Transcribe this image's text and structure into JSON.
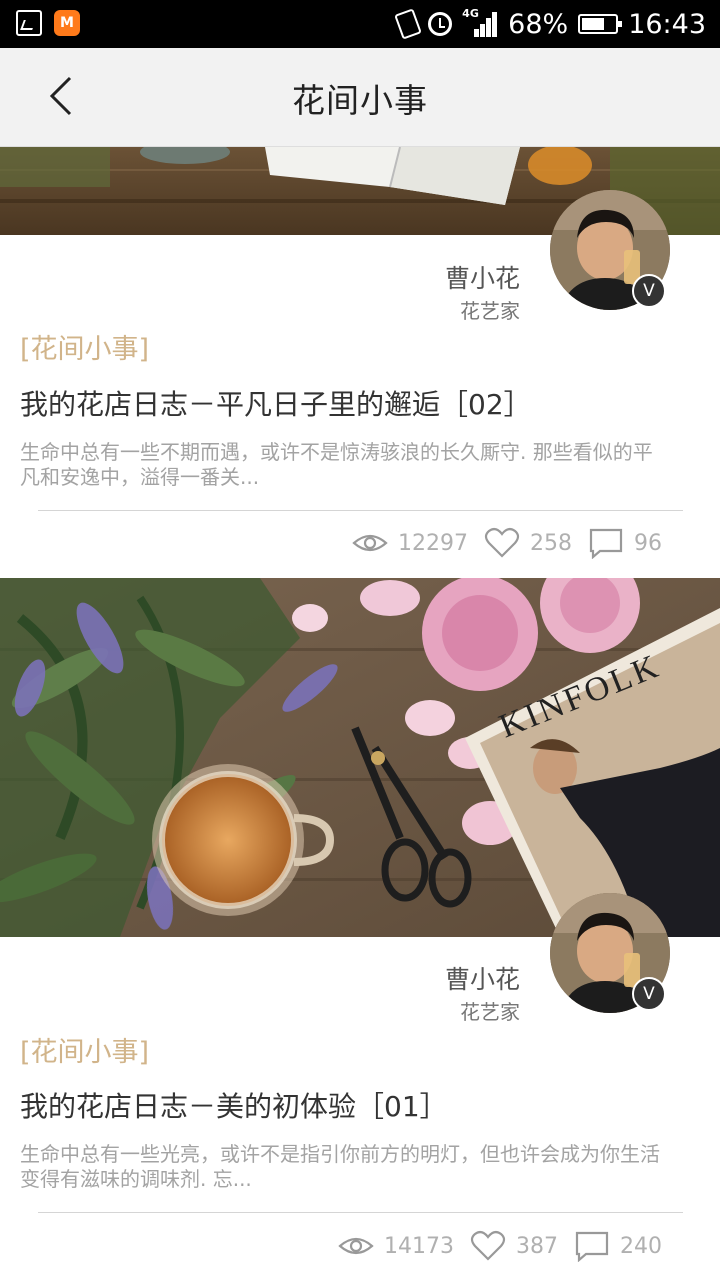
{
  "status_bar": {
    "battery": "68%",
    "time": "16:43",
    "network": "4G",
    "icons": [
      "gallery-icon",
      "mv-app-icon",
      "vibrate-icon",
      "alarm-icon",
      "signal-icon",
      "battery-icon"
    ],
    "battery_level": 0.68
  },
  "header": {
    "title": "花间小事",
    "back_icon": "chevron-left-icon"
  },
  "articles": [
    {
      "author_name": "曹小花",
      "author_role": "花艺家",
      "verified_badge": "V",
      "category": "[花间小事]",
      "title": "我的花店日志－平凡日子里的邂逅［02］",
      "excerpt": "生命中总有一些不期而遇，或许不是惊涛骇浪的长久厮守. 那些看似的平凡和安逸中，溢得一番关...",
      "views": "12297",
      "likes": "258",
      "comments": "96"
    },
    {
      "author_name": "曹小花",
      "author_role": "花艺家",
      "verified_badge": "V",
      "category": "[花间小事]",
      "title": "我的花店日志－美的初体验［01］",
      "excerpt": "生命中总有一些光亮，或许不是指引你前方的明灯，但也许会成为你生活变得有滋味的调味剂. 忘...",
      "views": "14173",
      "likes": "387",
      "comments": "240",
      "image_text": "KINFOLK"
    }
  ],
  "colors": {
    "category": "#d1b48a",
    "header_bg": "#f2f2f2",
    "status_bar_bg": "#000000"
  }
}
